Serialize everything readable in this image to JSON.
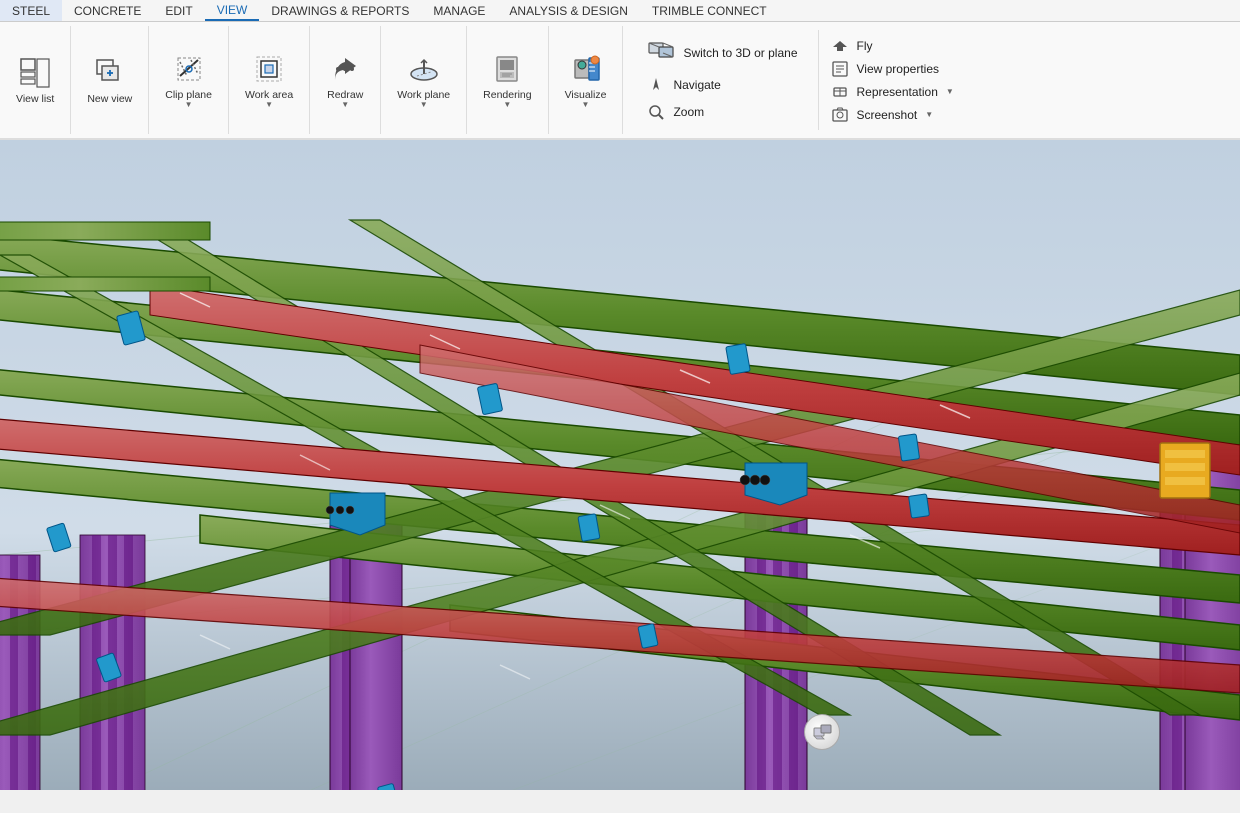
{
  "menubar": {
    "items": [
      {
        "label": "STEEL",
        "active": false
      },
      {
        "label": "CONCRETE",
        "active": false
      },
      {
        "label": "EDIT",
        "active": false
      },
      {
        "label": "VIEW",
        "active": true
      },
      {
        "label": "DRAWINGS & REPORTS",
        "active": false
      },
      {
        "label": "MANAGE",
        "active": false
      },
      {
        "label": "ANALYSIS & DESIGN",
        "active": false
      },
      {
        "label": "TRIMBLE CONNECT",
        "active": false
      }
    ]
  },
  "ribbon": {
    "groups": [
      {
        "name": "view-list-group",
        "items": [
          {
            "id": "view-list",
            "label": "View list",
            "icon": "view-list-icon"
          }
        ]
      },
      {
        "name": "new-view-group",
        "items": [
          {
            "id": "new-view",
            "label": "New view",
            "icon": "new-view-icon"
          }
        ]
      },
      {
        "name": "clip-plane-group",
        "items": [
          {
            "id": "clip-plane",
            "label": "Clip plane",
            "icon": "clip-plane-icon",
            "hasDropdown": true
          }
        ]
      },
      {
        "name": "work-area-group",
        "items": [
          {
            "id": "work-area",
            "label": "Work area",
            "icon": "work-area-icon",
            "hasDropdown": true
          }
        ]
      },
      {
        "name": "redraw-group",
        "items": [
          {
            "id": "redraw",
            "label": "Redraw",
            "icon": "redraw-icon",
            "hasDropdown": true
          }
        ]
      },
      {
        "name": "work-plane-group",
        "items": [
          {
            "id": "work-plane",
            "label": "Work plane",
            "icon": "work-plane-icon",
            "hasDropdown": true
          }
        ]
      },
      {
        "name": "rendering-group",
        "items": [
          {
            "id": "rendering",
            "label": "Rendering",
            "icon": "rendering-icon",
            "hasDropdown": true
          }
        ]
      },
      {
        "name": "visualize-group",
        "items": [
          {
            "id": "visualize",
            "label": "Visualize",
            "icon": "visualize-icon",
            "hasDropdown": true
          }
        ]
      }
    ],
    "right_section": {
      "switch_group": {
        "items": [
          {
            "id": "switch-3d",
            "label": "Switch to 3D or plane",
            "icon": "switch-3d-icon"
          }
        ]
      },
      "navigate_group": {
        "items": [
          {
            "id": "navigate",
            "label": "Navigate",
            "icon": "navigate-icon"
          },
          {
            "id": "zoom",
            "label": "Zoom",
            "icon": "zoom-icon"
          }
        ]
      },
      "fly_group": {
        "items": [
          {
            "id": "fly",
            "label": "Fly",
            "icon": "fly-icon"
          },
          {
            "id": "view-properties",
            "label": "View properties",
            "icon": "view-properties-icon"
          },
          {
            "id": "representation",
            "label": "Representation",
            "icon": "representation-icon",
            "hasDropdown": true
          },
          {
            "id": "screenshot",
            "label": "Screenshot",
            "icon": "screenshot-icon",
            "hasDropdown": true
          }
        ]
      }
    }
  },
  "viewport": {
    "nav_cube_label": "⊙"
  }
}
